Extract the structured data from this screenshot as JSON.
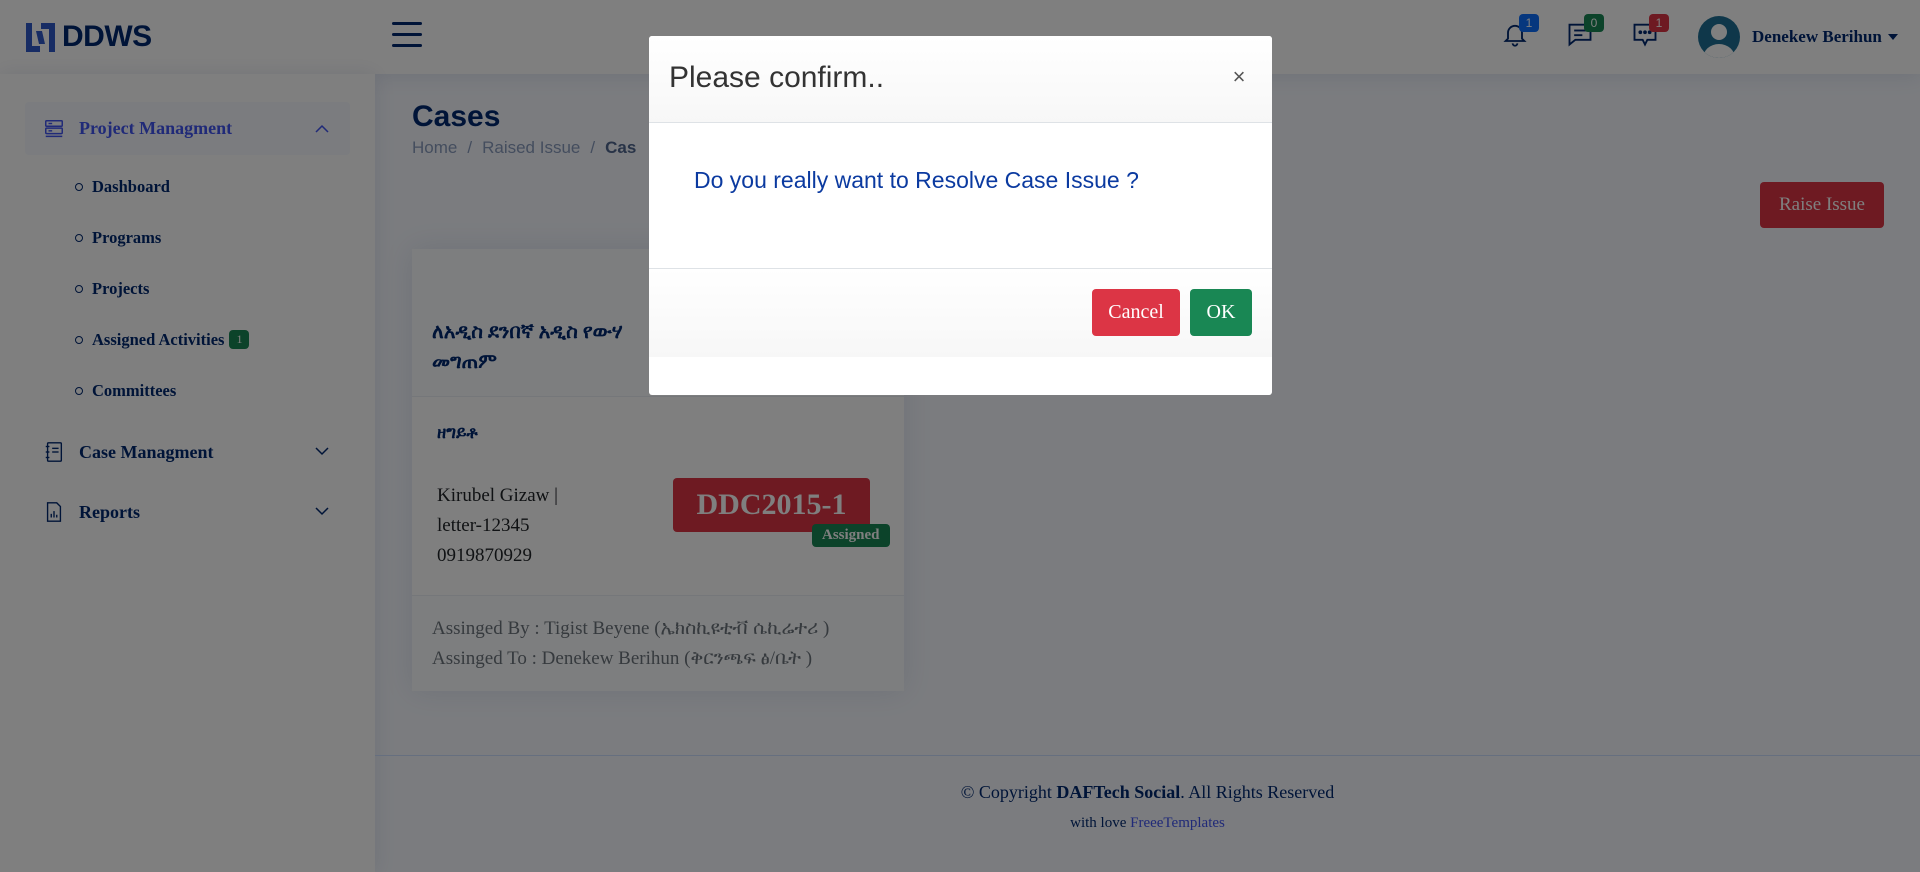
{
  "brand": {
    "name": "DDWS"
  },
  "header": {
    "notifications": {
      "icon": "bell-icon",
      "count": "1",
      "color": "#0d6efd"
    },
    "messages": {
      "icon": "chat-icon",
      "count": "0",
      "color": "#198754"
    },
    "chat": {
      "icon": "chat-dots-icon",
      "count": "1",
      "color": "#dc3545"
    },
    "user": {
      "name": "Denekew Berihun"
    }
  },
  "sidebar": {
    "project": {
      "label": "Project Managment",
      "items": [
        {
          "label": "Dashboard"
        },
        {
          "label": "Programs"
        },
        {
          "label": "Projects"
        },
        {
          "label": "Assigned Activities",
          "badge": "1"
        },
        {
          "label": "Committees"
        }
      ]
    },
    "case": {
      "label": "Case Managment"
    },
    "reports": {
      "label": "Reports"
    }
  },
  "page": {
    "title": "Cases",
    "breadcrumb": [
      "Home",
      "Raised Issue",
      "Cas"
    ]
  },
  "actions": {
    "raise_issue": "Raise Issue"
  },
  "case_card": {
    "title": "ለአዲስ ደንበኛ አዲስ የውሃ መግጠም",
    "type": "ዘግይቶ",
    "info": [
      "Kirubel Gizaw |",
      "letter-12345",
      "0919870929"
    ],
    "code": "DDC2015-1",
    "status": "Assigned",
    "assigned_by": "Assinged By : Tigist Beyene (ኤክስኪዩቲቭ ሴኪሬተሪ )",
    "assigned_to": "Assinged To : Denekew Berihun (ቅርንጫፍ ፅ/ቤት )"
  },
  "footer": {
    "copyright_prefix": "© Copyright ",
    "copyright_brand": "DAFTech Social",
    "copyright_suffix": ". All Rights Reserved",
    "credit_prefix": "with love ",
    "credit_link": "FreeeTemplates"
  },
  "modal": {
    "title": "Please confirm..",
    "close": "×",
    "message": "Do you really want to Resolve Case Issue ?",
    "cancel": "Cancel",
    "ok": "OK"
  },
  "colors": {
    "primary": "#012970",
    "accent": "#4154f1",
    "danger": "#dc3545",
    "success": "#198754"
  }
}
